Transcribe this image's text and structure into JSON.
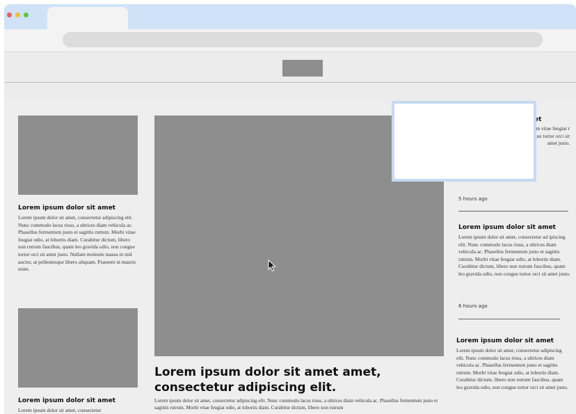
{
  "browser": {
    "window_controls": [
      {
        "name": "close",
        "color": "#ee5f57"
      },
      {
        "name": "minimize",
        "color": "#f5bd2f"
      },
      {
        "name": "maximize",
        "color": "#5fc83e"
      }
    ]
  },
  "left_column": {
    "articles": [
      {
        "title": "Lorem ipsum dolor sit amet",
        "body": "Lorem ipsum dolor sit amet, consectetur adipiscing elit. Nunc commodo lacus risus, a ultrices diam vehicula ac. Phasellus fermentum justo et sagittis rutrum. Morbi vitae feugiat odio, at lobortis diam. Curabitur dictum, libero non rutrum faucibus, quam leo gravida odio, non congue tortor orci sit amet justo. Nullam molestie massa in nisl auctor, at pellentesque libero aliquam. Praesent ut mauris enim."
      },
      {
        "title": "Lorem ipsum dolor sit amet",
        "body": "Lorem ipsum dolor sit amet, consectetur"
      }
    ]
  },
  "main_article": {
    "title": "Lorem ipsum dolor sit amet amet, consectetur adipiscing elit.",
    "body": "Lorem ipsum dolor sit amet, consectetur adipiscing elit. Nunc commodo lacus risus, a ultrices diam vehicula ac. Phasellus fermentum justo et sagittis rutrum. Morbi vitae feugiat odio, at lobortis diam. Curabitur dictum, libero non rutrum"
  },
  "right_column": {
    "partial_article": {
      "title_fragment": "et",
      "body": "sectetur lacus risus, a llus fermentum vitae feugiat r dictum, n leo gravida odio, non congue tortor orci sit amet justo.",
      "time": "5 hours ago"
    },
    "articles": [
      {
        "title": "Lorem ipsum dolor sit amet",
        "body": "Lorem ipsum dolor sit amet, consectetur ad ipiscing elit. Nunc commodo lacus risus, a ultrices diam vehicula ac. Phasellus fermentum justo et sagittis rutrum. Morbi vitae feugiat odio, at lobortis diam. Curabitur dictum, libero non rutrum faucibus, quam leo gravida odio, non congue tortor orci sit amet justo.",
        "time": "6 hours ago"
      },
      {
        "title": "Lorem ipsum dolor sit amet",
        "body": "Lorem ipsum dolor sit amet, consectetur adipiscing elit. Nunc commodo lacus risus, a ultrices diam vehicula ac. Phasellus fermentum justo et sagittis rutrum. Morbi vitae feugiat odio, at lobortis diam. Curabitur dictum, libero non rutrum faucibus, quam leo gravida odio, non congue tortor orci sit amet justo."
      }
    ]
  }
}
